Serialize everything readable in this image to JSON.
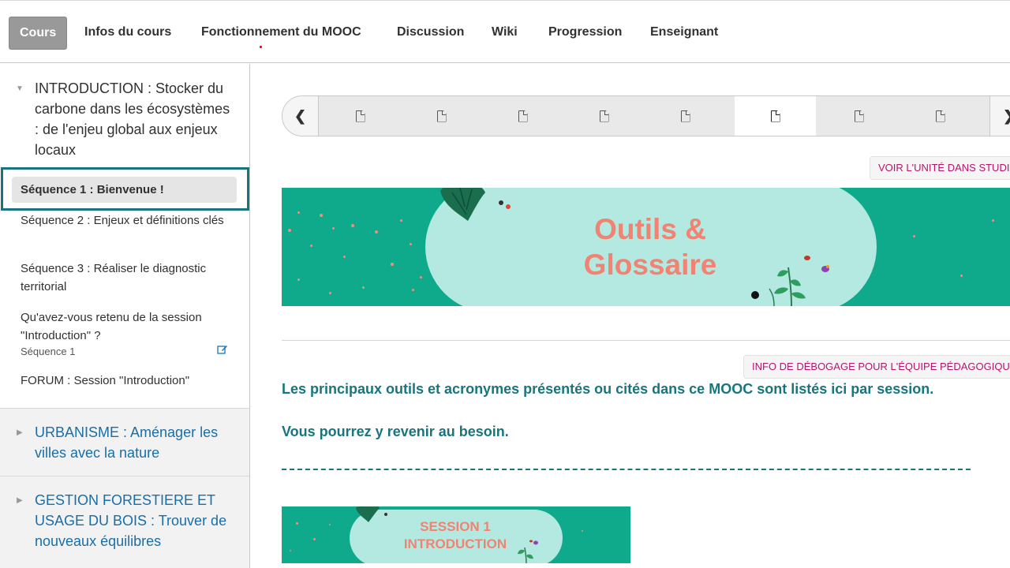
{
  "nav": {
    "tabs": [
      {
        "label": "Cours",
        "active": true
      },
      {
        "label": "Infos du cours"
      },
      {
        "label": "Fonctionnement du MOOC"
      },
      {
        "label": "Discussion"
      },
      {
        "label": "Wiki"
      },
      {
        "label": "Progression"
      },
      {
        "label": "Enseignant"
      }
    ]
  },
  "sidebar": {
    "chapters": [
      {
        "title": "INTRODUCTION : Stocker du carbone dans les écosystèmes : de l'enjeu global aux enjeux locaux",
        "expanded": true,
        "sequences": [
          {
            "label": "Séquence 1 : Bienvenue !",
            "active": true
          },
          {
            "label": "Séquence 2 : Enjeux et définitions clés"
          },
          {
            "label": "Séquence 3 : Réaliser le diagnostic territorial"
          },
          {
            "label": "Qu'avez-vous retenu de la session \"Introduction\" ?",
            "sub": "Séquence 1"
          },
          {
            "label": "FORUM : Session \"Introduction\""
          }
        ]
      },
      {
        "title": "URBANISME : Aménager les villes avec la nature",
        "expanded": false
      },
      {
        "title": "GESTION FORESTIERE ET USAGE DU BOIS : Trouver de nouveaux équilibres",
        "expanded": false
      }
    ]
  },
  "main": {
    "active_unit_index": 5,
    "staff": {
      "view_in_studio": "VOIR L'UNITÉ DANS STUDIO",
      "debug_info": "INFO DE DÉBOGAGE POUR L'ÉQUIPE PÉDAGOGIQUE"
    },
    "banner": {
      "line1": "Outils &",
      "line2": "Glossaire"
    },
    "paragraph1": "Les principaux outils et acronymes présentés ou cités dans ce MOOC sont listés ici par session.",
    "paragraph2": "Vous pourrez y revenir au besoin.",
    "session_banner": {
      "line1": "SESSION 1",
      "line2": "INTRODUCTION"
    }
  },
  "colors": {
    "teal": "#0faa8c",
    "mint": "#b4e9e2",
    "coral": "#f08372",
    "text_teal": "#18757d",
    "link_blue": "#1a6ea8",
    "staff_pink": "#b5166b"
  },
  "icons": [
    "chevron-left-icon",
    "chevron-right-icon",
    "document-icon",
    "edit-icon",
    "caret-down-icon",
    "caret-right-icon"
  ]
}
